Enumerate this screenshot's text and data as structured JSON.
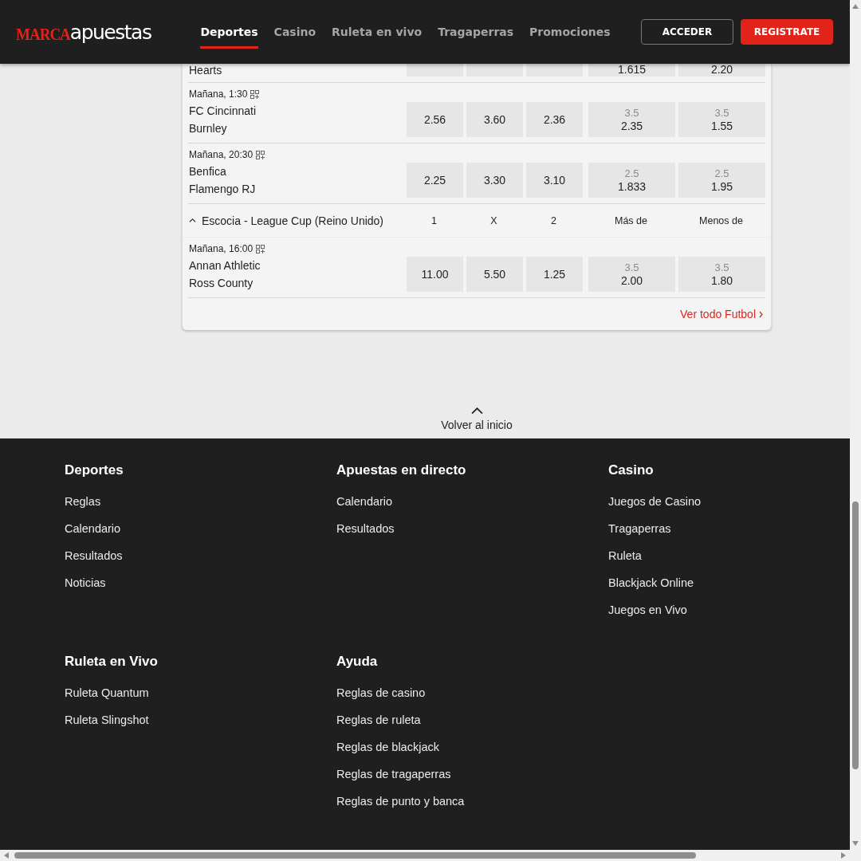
{
  "header": {
    "logo": {
      "brand": "MARCA",
      "product": "apuestas"
    },
    "nav": [
      {
        "label": "Deportes",
        "selected": true
      },
      {
        "label": "Casino",
        "selected": false
      },
      {
        "label": "Ruleta en vivo",
        "selected": false
      },
      {
        "label": "Tragaperras",
        "selected": false
      },
      {
        "label": "Promociones",
        "selected": false
      }
    ],
    "buttons": [
      {
        "label": "ACCEDER",
        "kind": "outline"
      },
      {
        "label": "REGISTRATE",
        "kind": "primary"
      }
    ]
  },
  "events": {
    "groups": [
      {
        "matches": [
          {
            "kind": "partial",
            "teams": [
              "Hearts"
            ],
            "totals": [
              {
                "price": "1.615"
              },
              {
                "price": "2.20"
              }
            ]
          },
          {
            "kind": "full",
            "time": "Mañana, 1:30",
            "teams": [
              "FC Cincinnati",
              "Burnley"
            ],
            "odds": [
              "2.56",
              "3.60",
              "2.36"
            ],
            "totals": [
              {
                "line": "3.5",
                "price": "2.35"
              },
              {
                "line": "3.5",
                "price": "1.55"
              }
            ]
          },
          {
            "kind": "full",
            "time": "Mañana, 20:30",
            "teams": [
              "Benfica",
              "Flamengo RJ"
            ],
            "odds": [
              "2.25",
              "3.30",
              "3.10"
            ],
            "totals": [
              {
                "line": "2.5",
                "price": "1.833"
              },
              {
                "line": "2.5",
                "price": "1.95"
              }
            ]
          }
        ]
      },
      {
        "title": "Escocia - League Cup (Reino Unido)",
        "expanded": true,
        "columns": [
          "1",
          "X",
          "2",
          "Más de",
          "Menos de"
        ],
        "matches": [
          {
            "kind": "full",
            "time": "Mañana, 16:00",
            "teams": [
              "Annan Athletic",
              "Ross County"
            ],
            "odds": [
              "11.00",
              "5.50",
              "1.25"
            ],
            "totals": [
              {
                "line": "3.5",
                "price": "2.00"
              },
              {
                "line": "3.5",
                "price": "1.80"
              }
            ]
          }
        ]
      }
    ],
    "see_all": "Ver todo Futbol"
  },
  "back_to_top": "Volver al inicio",
  "footer": {
    "sections": [
      {
        "title": "Deportes",
        "links": [
          "Reglas",
          "Calendario",
          "Resultados",
          "Noticias"
        ]
      },
      {
        "title": "Apuestas en directo",
        "links": [
          "Calendario",
          "Resultados"
        ]
      },
      {
        "title": "Casino",
        "links": [
          "Juegos de Casino",
          "Tragaperras",
          "Ruleta",
          "Blackjack Online",
          "Juegos en Vivo"
        ]
      },
      {
        "title": "Ruleta en Vivo",
        "links": [
          "Ruleta Quantum",
          "Ruleta Slingshot"
        ]
      },
      {
        "title": "Ayuda",
        "links": [
          "Reglas de casino",
          "Reglas de ruleta",
          "Reglas de blackjack",
          "Reglas de tragaperras",
          "Reglas de punto y banca"
        ]
      }
    ]
  }
}
